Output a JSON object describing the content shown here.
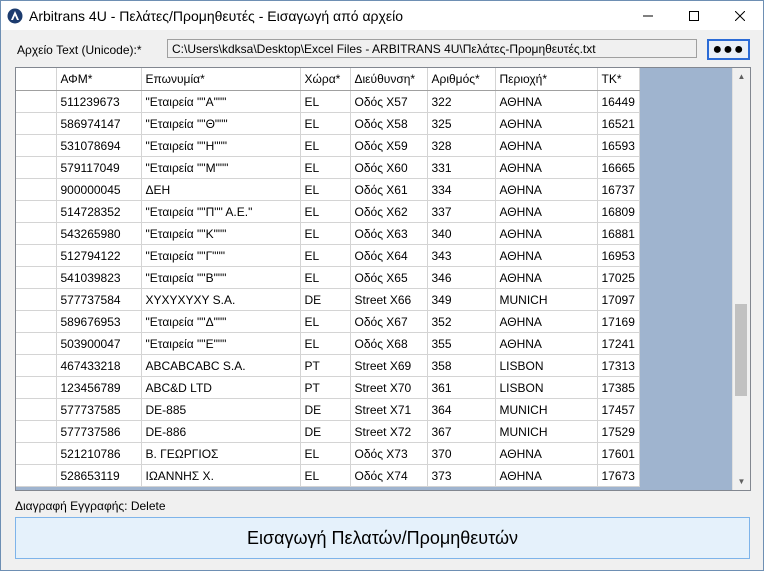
{
  "window": {
    "title": "Arbitrans 4U - Πελάτες/Προμηθευτές - Εισαγωγή από αρχείο",
    "minimize": "—",
    "maximize": "☐",
    "close": "✕"
  },
  "file": {
    "label": "Αρχείο Text (Unicode):*",
    "path": "C:\\Users\\kdksa\\Desktop\\Excel Files - ARBITRANS 4U\\Πελάτες-Προμηθευτές.txt",
    "browse_label": "●●●"
  },
  "grid": {
    "columns": [
      "ΑΦΜ*",
      "Επωνυμία*",
      "Χώρα*",
      "Διεύθυνση*",
      "Αριθμός*",
      "Περιοχή*",
      "ΤΚ*"
    ],
    "rows": [
      [
        "511239673",
        "\"Εταιρεία \"\"Α\"\"\"",
        "EL",
        "Οδός Χ57",
        "322",
        "ΑΘΗΝΑ",
        "16449"
      ],
      [
        "586974147",
        "\"Εταιρεία \"\"Θ\"\"\"",
        "EL",
        "Οδός Χ58",
        "325",
        "ΑΘΗΝΑ",
        "16521"
      ],
      [
        "531078694",
        "\"Εταιρεία \"\"Η\"\"\"",
        "EL",
        "Οδός Χ59",
        "328",
        "ΑΘΗΝΑ",
        "16593"
      ],
      [
        "579117049",
        "\"Εταιρεία \"\"Μ\"\"\"",
        "EL",
        "Οδός Χ60",
        "331",
        "ΑΘΗΝΑ",
        "16665"
      ],
      [
        "900000045",
        "ΔΕΗ",
        "EL",
        "Οδός Χ61",
        "334",
        "ΑΘΗΝΑ",
        "16737"
      ],
      [
        "514728352",
        "\"Εταιρεία \"\"Π\"\" Α.Ε.\"",
        "EL",
        "Οδός Χ62",
        "337",
        "ΑΘΗΝΑ",
        "16809"
      ],
      [
        "543265980",
        "\"Εταιρεία \"\"Κ\"\"\"",
        "EL",
        "Οδός Χ63",
        "340",
        "ΑΘΗΝΑ",
        "16881"
      ],
      [
        "512794122",
        "\"Εταιρεία \"\"Γ\"\"\"",
        "EL",
        "Οδός Χ64",
        "343",
        "ΑΘΗΝΑ",
        "16953"
      ],
      [
        "541039823",
        "\"Εταιρεία \"\"Β\"\"\"",
        "EL",
        "Οδός Χ65",
        "346",
        "ΑΘΗΝΑ",
        "17025"
      ],
      [
        "577737584",
        "ΧΥΧΥΧΥΧΥ S.A.",
        "DE",
        "Street X66",
        "349",
        "MUNICH",
        "17097"
      ],
      [
        "589676953",
        "\"Εταιρεία \"\"Δ\"\"\"",
        "EL",
        "Οδός Χ67",
        "352",
        "ΑΘΗΝΑ",
        "17169"
      ],
      [
        "503900047",
        "\"Εταιρεία \"\"Ε\"\"\"",
        "EL",
        "Οδός Χ68",
        "355",
        "ΑΘΗΝΑ",
        "17241"
      ],
      [
        "467433218",
        "ABCABCABC S.A.",
        "PT",
        "Street X69",
        "358",
        "LISBON",
        "17313"
      ],
      [
        "123456789",
        "ABC&D LTD",
        "PT",
        "Street X70",
        "361",
        "LISBON",
        "17385"
      ],
      [
        "577737585",
        "DE-885",
        "DE",
        "Street X71",
        "364",
        "MUNICH",
        "17457"
      ],
      [
        "577737586",
        "DE-886",
        "DE",
        "Street X72",
        "367",
        "MUNICH",
        "17529"
      ],
      [
        "521210786",
        "Β. ΓΕΩΡΓΙΟΣ",
        "EL",
        "Οδός Χ73",
        "370",
        "ΑΘΗΝΑ",
        "17601"
      ],
      [
        "528653119",
        "ΙΩΑΝΝΗΣ Χ.",
        "EL",
        "Οδός Χ74",
        "373",
        "ΑΘΗΝΑ",
        "17673"
      ]
    ],
    "scroll_position": 0.74
  },
  "hint": "Διαγραφή Εγγραφής: Delete",
  "import_button": "Εισαγωγή Πελατών/Προμηθευτών",
  "colors": {
    "grid_background": "#9fb4cf",
    "button_border": "#7eb4ea",
    "browse_border": "#2b6bd6"
  }
}
